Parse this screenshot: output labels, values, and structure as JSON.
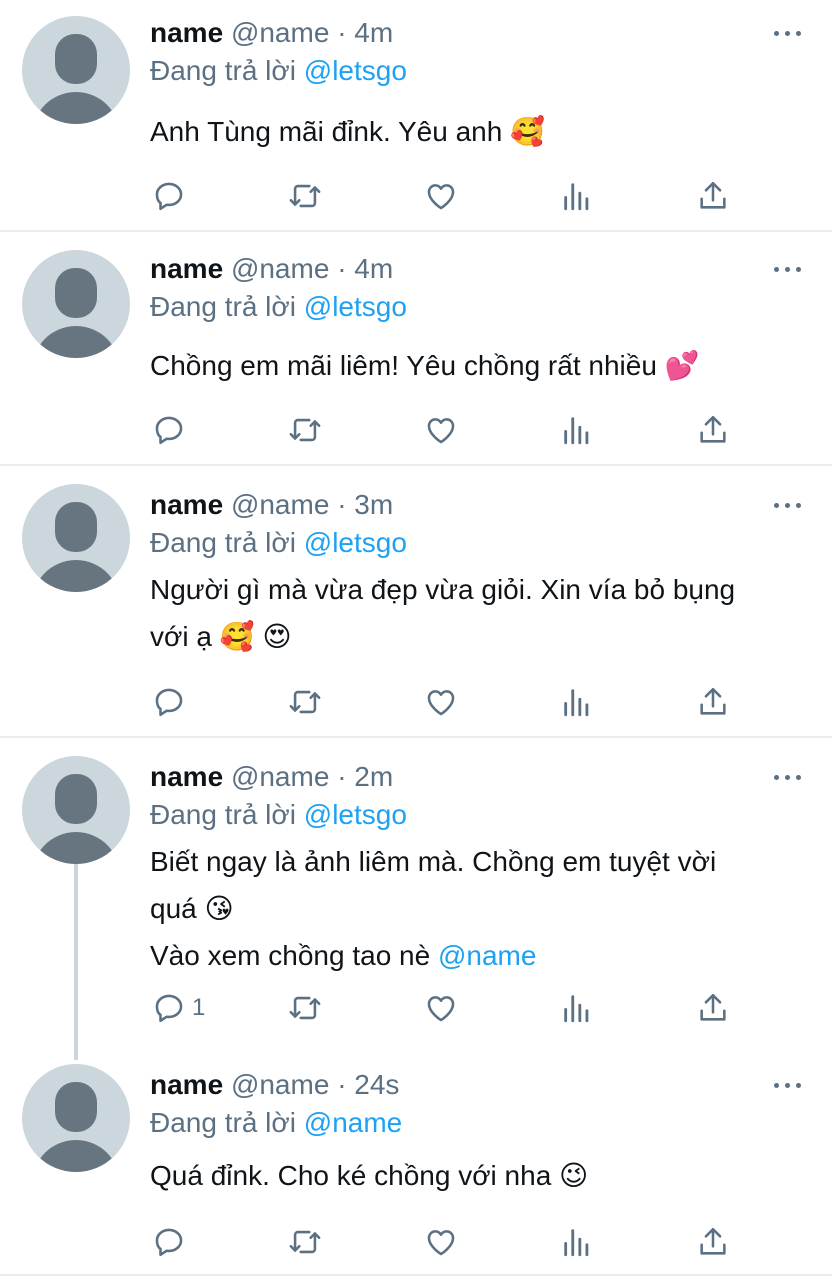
{
  "tweets": [
    {
      "name": "name",
      "handle": "@name",
      "time": "· 4m",
      "reply_prefix": "Đang trả lời",
      "reply_to": "@letsgo",
      "text_lines": [
        "Anh Tùng mãi đỉnk. Yêu anh 🥰"
      ],
      "reply_count": ""
    },
    {
      "name": "name",
      "handle": "@name",
      "time": "· 4m",
      "reply_prefix": "Đang trả lời",
      "reply_to": "@letsgo",
      "text_lines": [
        "Chồng em mãi liêm! Yêu chồng rất nhiều 💕"
      ],
      "reply_count": ""
    },
    {
      "name": "name",
      "handle": "@name",
      "time": "· 3m",
      "reply_prefix": "Đang trả lời",
      "reply_to": "@letsgo",
      "text_lines": [
        "Người gì mà vừa đẹp vừa giỏi. Xin vía bỏ bụng",
        "với ạ 🥰 😍"
      ],
      "reply_count": ""
    },
    {
      "name": "name",
      "handle": "@name",
      "time": "· 2m",
      "reply_prefix": "Đang trả lời",
      "reply_to": "@letsgo",
      "text_lines": [
        "Biết ngay là ảnh liêm mà. Chồng em tuyệt vời",
        "quá 😘"
      ],
      "text_last_prefix": "Vào xem chồng tao nè ",
      "text_last_mention": "@name",
      "reply_count": "1"
    },
    {
      "name": "name",
      "handle": "@name",
      "time": "· 24s",
      "reply_prefix": "Đang trả lời",
      "reply_to": "@name",
      "text_lines": [
        "Quá đỉnk. Cho ké chồng với nha 😉"
      ],
      "reply_count": ""
    }
  ],
  "icons": [
    "reply-icon",
    "retweet-icon",
    "like-icon",
    "analytics-icon",
    "share-icon",
    "more-icon"
  ],
  "colors": {
    "link": "#1da1f2",
    "muted": "#5b7083",
    "avatar_bg": "#ccd6dd",
    "avatar_fg": "#66757f",
    "divider": "#e6ecf0"
  }
}
